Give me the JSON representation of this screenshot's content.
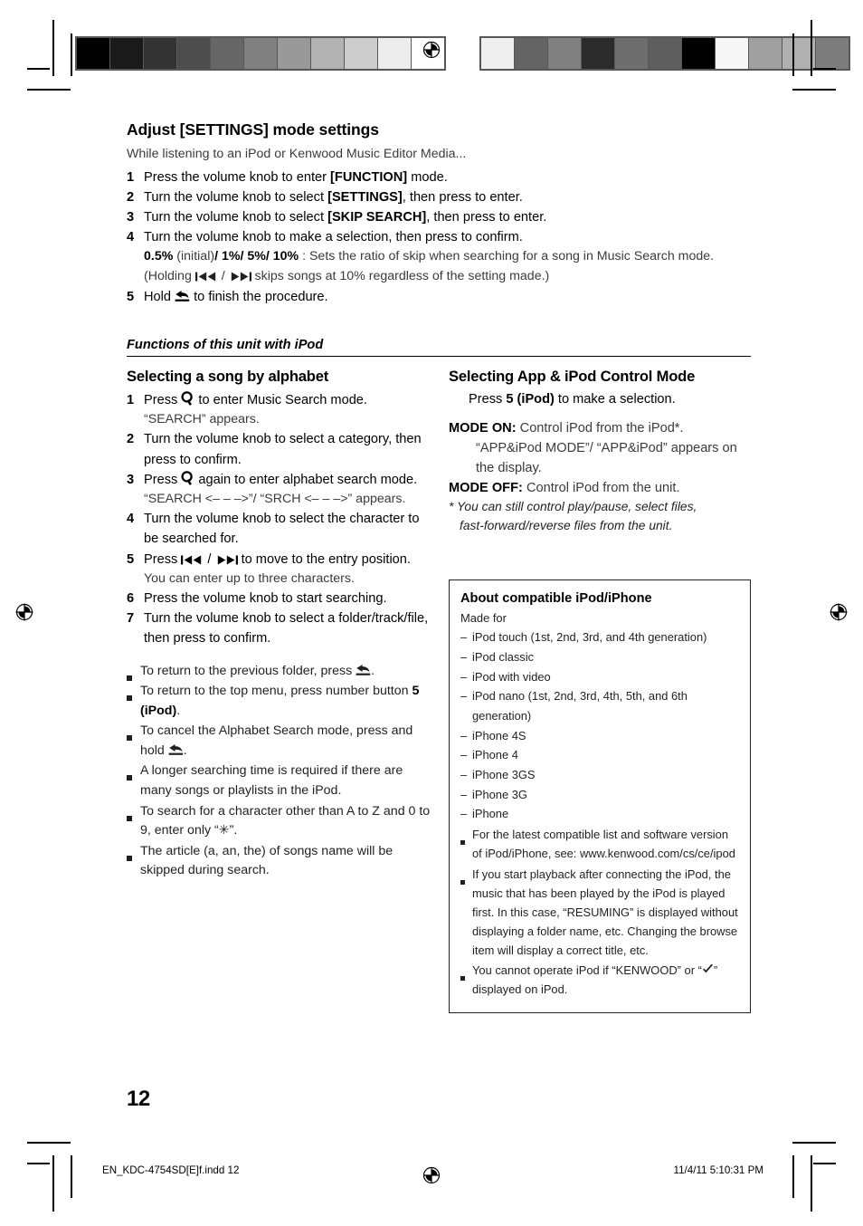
{
  "document": {
    "page_number": "12",
    "footer_left": "EN_KDC-4754SD[E]f.indd   12",
    "footer_right": "11/4/11   5:10:31 PM"
  },
  "calibration": {
    "left_swatches": [
      "#000000",
      "#1a1a1a",
      "#333333",
      "#4d4d4d",
      "#666666",
      "#808080",
      "#999999",
      "#b3b3b3",
      "#cccccc",
      "#ededed",
      "#ffffff"
    ],
    "right_swatches": [
      "#efefef",
      "#646464",
      "#808080",
      "#2b2b2b",
      "#6e6e6e",
      "#5e5e5e",
      "#000000",
      "#f7f7f7",
      "#a0a0a0",
      "#b0b0b0",
      "#7d7d7d"
    ]
  },
  "settings_section": {
    "title": "Adjust [SETTINGS] mode settings",
    "lead": "While listening to an iPod or Kenwood Music Editor Media...",
    "steps": [
      {
        "num": "1",
        "pre": "Press the volume knob to enter ",
        "bold": "[FUNCTION]",
        "post": " mode."
      },
      {
        "num": "2",
        "pre": "Turn the volume knob to select ",
        "bold": "[SETTINGS]",
        "post": ", then press to enter."
      },
      {
        "num": "3",
        "pre": "Turn the volume knob to select ",
        "bold": "[SKIP SEARCH]",
        "post": ", then press to enter."
      },
      {
        "num": "4",
        "pre": "Turn the volume knob to make a selection, then press to confirm.",
        "bold": "",
        "post": ""
      }
    ],
    "ratio_bold_1": "0.5%",
    "ratio_initial": " (initial)",
    "ratio_bold_2": "/ 1%/ 5%/ 10%",
    "ratio_rest": " : Sets the ratio of skip when searching for a song in Music Search mode.",
    "holding_pre": "(Holding ",
    "holding_mid": " / ",
    "holding_post": " skips songs at 10% regardless of the setting made.)",
    "step5_num": "5",
    "step5_pre": "Hold ",
    "step5_post": " to finish the procedure."
  },
  "subsection": {
    "title": "Functions of this unit with iPod"
  },
  "alphabet_section": {
    "title": "Selecting a song by alphabet",
    "steps": [
      {
        "num": "1",
        "pre": "Press ",
        "icon": "search-icon",
        "post": " to enter Music Search mode.",
        "sub": "“SEARCH” appears."
      },
      {
        "num": "2",
        "pre": "Turn the volume knob to select a category, then press to confirm.",
        "icon": "",
        "post": "",
        "sub": ""
      },
      {
        "num": "3",
        "pre": "Press ",
        "icon": "search-icon",
        "post": " again to enter alphabet search mode.",
        "sub": "“SEARCH <– – –>”/ “SRCH <– – –>” appears."
      },
      {
        "num": "4",
        "pre": "Turn the volume knob to select the character to be searched for.",
        "icon": "",
        "post": "",
        "sub": ""
      },
      {
        "num": "5",
        "pre": "Press ",
        "icon": "prev-next-icons",
        "post": " to move to the entry position.",
        "sub": "You can enter up to three characters."
      },
      {
        "num": "6",
        "pre": "Press the volume knob to start searching.",
        "icon": "",
        "post": "",
        "sub": ""
      },
      {
        "num": "7",
        "pre": "Turn the volume knob to select a folder/track/file, then press to confirm.",
        "icon": "",
        "post": "",
        "sub": ""
      }
    ],
    "bullets": [
      {
        "pre": "To return to the previous folder, press ",
        "icon": "back-icon",
        "post": ".",
        "bold": ""
      },
      {
        "pre": "To return to the top menu, press number button ",
        "icon": "",
        "post": ".",
        "bold": "5 (iPod)"
      },
      {
        "pre": "To cancel the Alphabet Search mode, press and hold ",
        "icon": "back-icon",
        "post": ".",
        "bold": ""
      },
      {
        "pre": "A longer searching time is required if there are many songs or playlists in the iPod.",
        "icon": "",
        "post": "",
        "bold": ""
      },
      {
        "pre": "To search for a character other than A to Z and 0 to 9, enter only “✳”.",
        "icon": "",
        "post": "",
        "bold": ""
      },
      {
        "pre": "The article (a, an, the) of songs name will be skipped during search.",
        "icon": "",
        "post": "",
        "bold": ""
      }
    ]
  },
  "control_mode_section": {
    "title": "Selecting App & iPod Control Mode",
    "intro_pre": "Press ",
    "intro_bold": "5 (iPod)",
    "intro_post": " to make a selection.",
    "mode_on_label": "MODE ON:",
    "mode_on_text": " Control iPod from the iPod*.",
    "mode_on_indent": "“APP&iPod MODE”/ “APP&iPod” appears on the display.",
    "mode_off_label": "MODE OFF:",
    "mode_off_text": " Control iPod from the unit.",
    "footnote_line1": "* You can still control play/pause, select files,",
    "footnote_line2": "fast-forward/reverse files from the unit."
  },
  "compat_box": {
    "title": "About compatible iPod/iPhone",
    "made_for": "Made for",
    "devices": [
      "iPod touch (1st, 2nd, 3rd, and 4th generation)",
      "iPod classic",
      "iPod with video",
      "iPod nano (1st, 2nd, 3rd, 4th, 5th, and 6th generation)",
      "iPhone 4S",
      "iPhone 4",
      "iPhone 3GS",
      "iPhone 3G",
      "iPhone"
    ],
    "notes": [
      "For the latest compatible list and software version of iPod/iPhone, see: www.kenwood.com/cs/ce/ipod",
      "If you start playback after connecting the iPod, the music that has been played by the iPod is played first. In this case, “RESUMING” is displayed without displaying a folder name, etc. Changing the browse item will display a correct title, etc."
    ],
    "note_check_pre": "You cannot operate iPod if “KENWOOD” or “",
    "note_check_post": "” displayed on iPod."
  }
}
